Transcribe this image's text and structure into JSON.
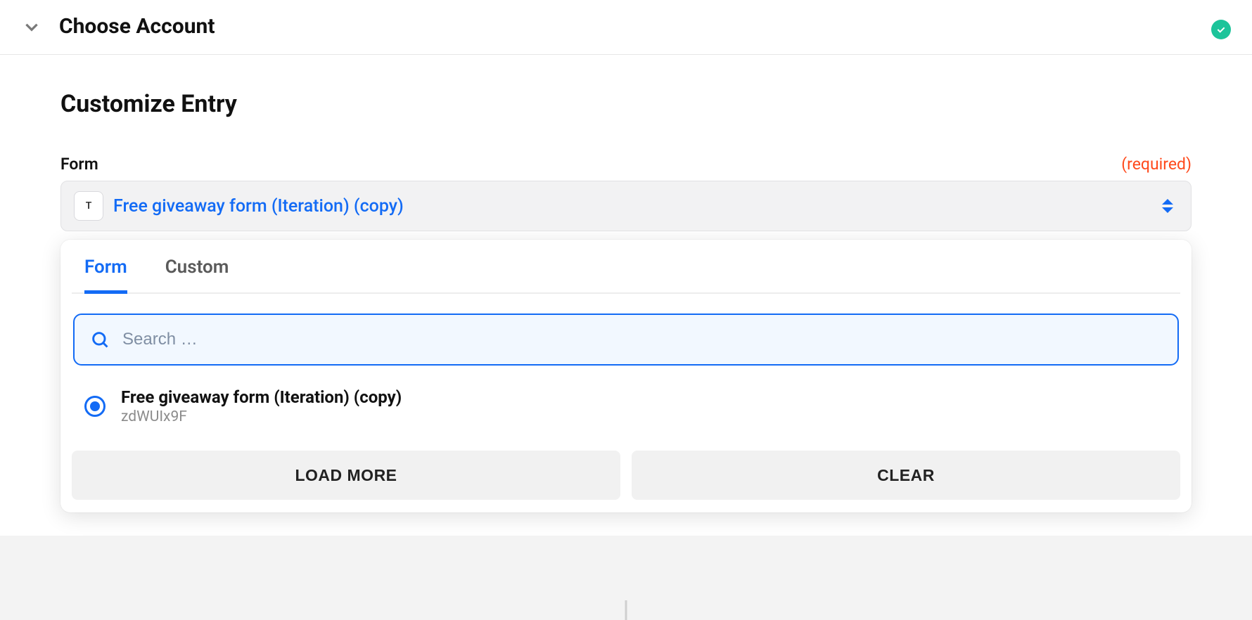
{
  "header": {
    "title": "Choose Account"
  },
  "section": {
    "title": "Customize Entry"
  },
  "field": {
    "label": "Form",
    "required_text": "(required)",
    "icon_letter": "T",
    "selected_value": "Free giveaway form (Iteration) (copy)"
  },
  "dropdown": {
    "tabs": {
      "form": "Form",
      "custom": "Custom"
    },
    "search": {
      "placeholder": "Search …",
      "value": ""
    },
    "options": [
      {
        "title": "Free giveaway form (Iteration) (copy)",
        "subtitle": "zdWUIx9F",
        "selected": true
      }
    ],
    "buttons": {
      "load_more": "LOAD MORE",
      "clear": "CLEAR"
    }
  }
}
